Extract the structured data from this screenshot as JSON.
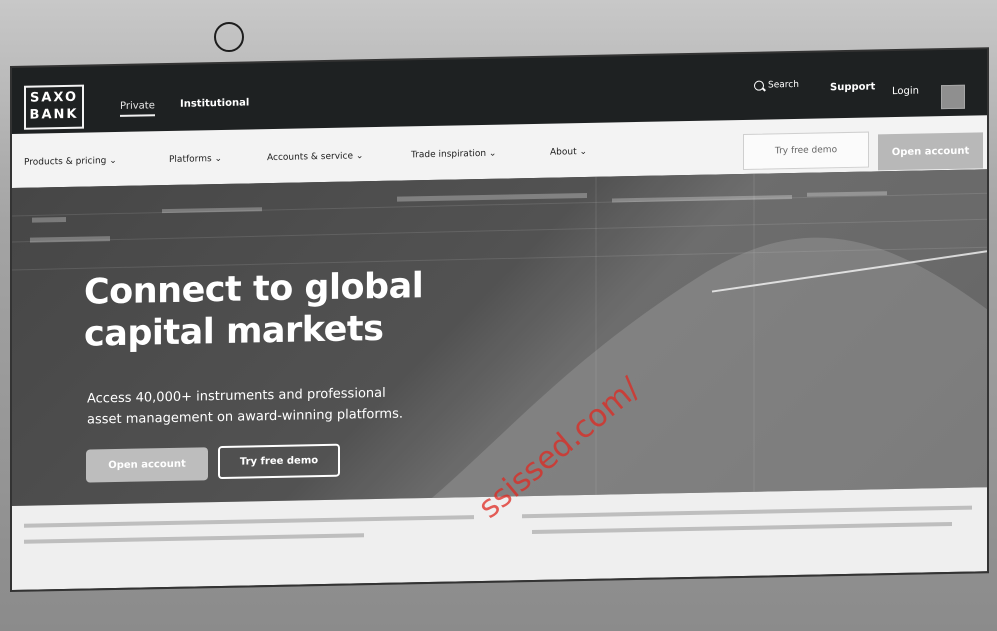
{
  "header": {
    "logo": [
      "SAXO",
      "BANK"
    ],
    "nav": [
      "Private",
      "Institutional"
    ],
    "search_label": "Search",
    "support_label": "Support",
    "login_label": "Login"
  },
  "subnav": {
    "items": [
      "Products & pricing ⌄",
      "Platforms ⌄",
      "Accounts & service ⌄",
      "Trade inspiration ⌄",
      "About ⌄"
    ],
    "try_demo": "Try free demo",
    "open_account": "Open account"
  },
  "hero": {
    "title_line_1": "Connect to global",
    "title_line_2": "capital markets",
    "subtitle_line_1": "Access 40,000+ instruments and professional",
    "subtitle_line_2": "asset management on award-winning platforms.",
    "open_button": "Open account",
    "demo_button": "Try free demo"
  },
  "watermark": "ssissed.com/",
  "icons": {
    "camera": "camera-icon",
    "search": "search-icon"
  }
}
